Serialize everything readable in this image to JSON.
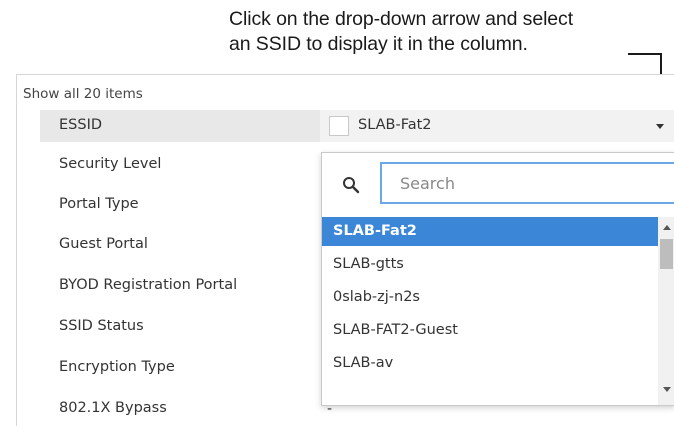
{
  "annotation": {
    "line1": "Click on the drop-down arrow and select",
    "line2": "an SSID to display it in the column."
  },
  "table": {
    "show_all": "Show all 20 items",
    "rows": [
      "ESSID",
      "Security Level",
      "Portal Type",
      "Guest Portal",
      "BYOD Registration Portal",
      "SSID Status",
      "Encryption Type",
      "802.1X Bypass"
    ],
    "bypass_value": "-"
  },
  "essid_select": {
    "value": "SLAB-Fat2"
  },
  "dropdown": {
    "search_placeholder": "Search",
    "options": [
      "SLAB-Fat2",
      "SLAB-gtts",
      "0slab-zj-n2s",
      "SLAB-FAT2-Guest",
      "SLAB-av"
    ],
    "selected_index": 0
  },
  "colors": {
    "selected_bg": "#3b86d6",
    "search_border": "#6aa9e3",
    "row_highlight": "#e8e8e8"
  }
}
